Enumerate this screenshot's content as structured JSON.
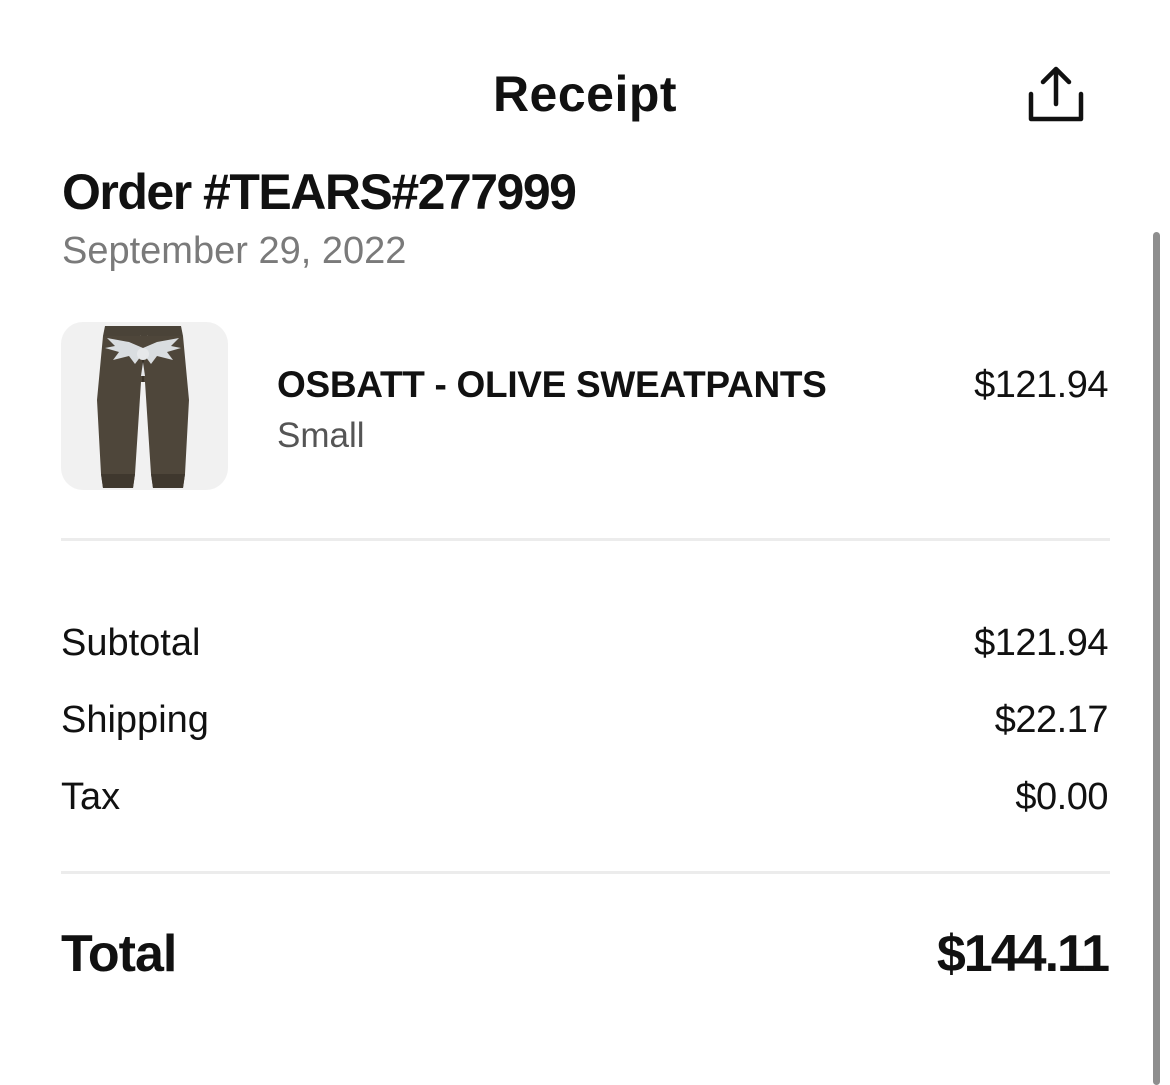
{
  "header": {
    "title": "Receipt",
    "share_icon": "share-icon"
  },
  "order": {
    "number": "Order #TEARS#277999",
    "date": "September 29, 2022"
  },
  "items": [
    {
      "name": "OSBATT - OLIVE SWEATPANTS",
      "variant": "Small",
      "price": "$121.94",
      "image": "sweatpants-thumbnail"
    }
  ],
  "summary": {
    "subtotal_label": "Subtotal",
    "subtotal_value": "$121.94",
    "shipping_label": "Shipping",
    "shipping_value": "$22.17",
    "tax_label": "Tax",
    "tax_value": "$0.00"
  },
  "total": {
    "label": "Total",
    "value": "$144.11"
  },
  "colors": {
    "text": "#111111",
    "muted": "#7a7a7a",
    "divider": "#ececec",
    "thumb_bg": "#f1f1f1"
  }
}
